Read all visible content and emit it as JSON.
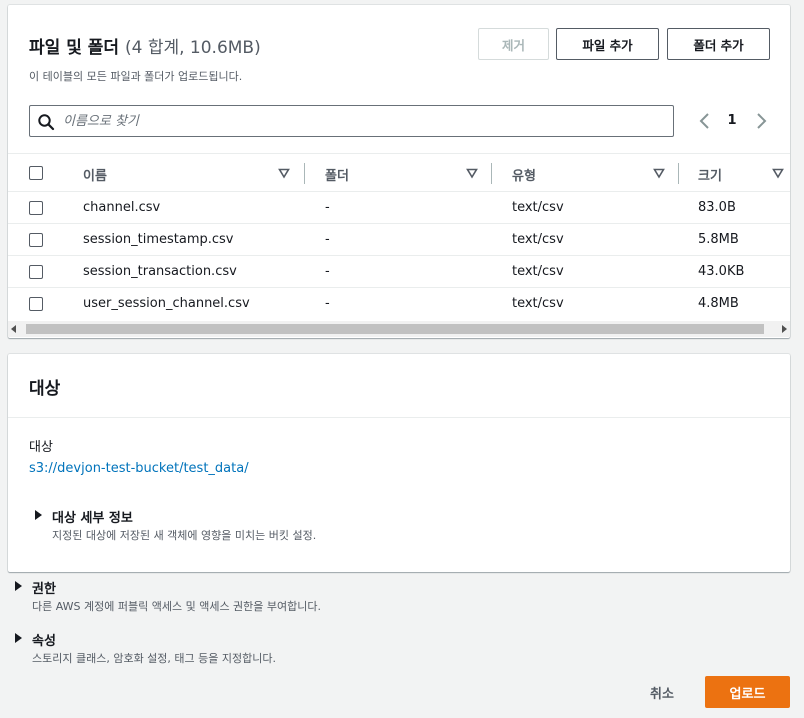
{
  "files_panel": {
    "title": "파일 및 폴더",
    "count": "(4 합계, 10.6MB)",
    "description": "이 테이블의 모든 파일과 폴더가 업로드됩니다.",
    "buttons": {
      "remove": "제거",
      "add_files": "파일 추가",
      "add_folder": "폴더 추가"
    },
    "search": {
      "placeholder": "이름으로 찾기",
      "value": ""
    },
    "pagination": {
      "current_page": "1"
    },
    "table": {
      "columns": [
        "이름",
        "폴더",
        "유형",
        "크기"
      ],
      "rows": [
        {
          "name": "channel.csv",
          "folder": "-",
          "type": "text/csv",
          "size": "83.0B"
        },
        {
          "name": "session_timestamp.csv",
          "folder": "-",
          "type": "text/csv",
          "size": "5.8MB"
        },
        {
          "name": "session_transaction.csv",
          "folder": "-",
          "type": "text/csv",
          "size": "43.0KB"
        },
        {
          "name": "user_session_channel.csv",
          "folder": "-",
          "type": "text/csv",
          "size": "4.8MB"
        }
      ]
    }
  },
  "destination_panel": {
    "title": "대상",
    "label": "대상",
    "link": "s3://devjon-test-bucket/test_data/",
    "details": {
      "title": "대상 세부 정보",
      "description": "지정된 대상에 저장된 새 객체에 영향을 미치는 버킷 설정."
    }
  },
  "permissions": {
    "title": "권한",
    "description": "다른 AWS 계정에 퍼블릭 액세스 및 액세스 권한을 부여합니다."
  },
  "properties": {
    "title": "속성",
    "description": "스토리지 클래스, 암호화 설정, 태그 등을 지정합니다."
  },
  "footer": {
    "cancel": "취소",
    "upload": "업로드"
  },
  "colors": {
    "primary": "#ec7211",
    "link": "#0073bb",
    "background": "#f2f3f3"
  }
}
